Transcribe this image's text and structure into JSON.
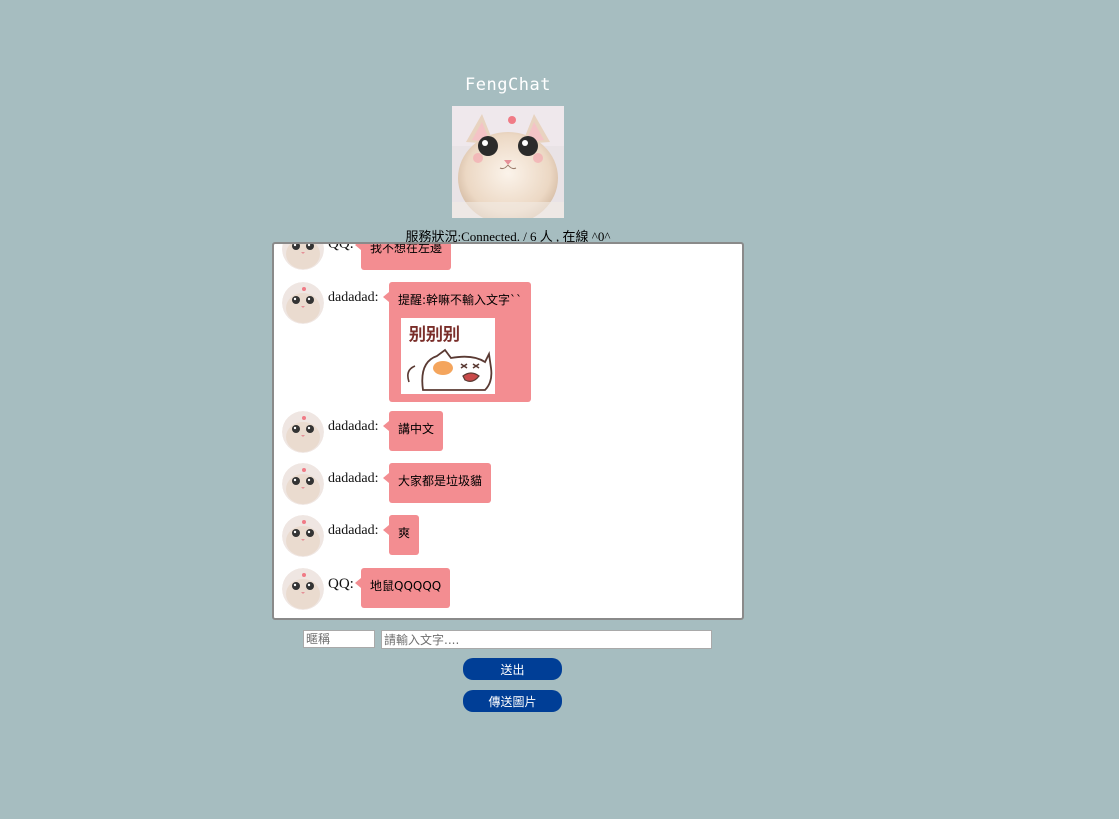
{
  "app": {
    "title": "FengChat",
    "status": "服務狀況:Connected. / 6 人 , 在線 ^0^"
  },
  "messages": [
    {
      "nick": "QQ:",
      "text": "我不想在左邊"
    },
    {
      "nick": "dadadad:",
      "text": "提醒:幹嘛不輸入文字``",
      "sticker": {
        "caption": "别别别"
      }
    },
    {
      "nick": "dadadad:",
      "text": "講中文"
    },
    {
      "nick": "dadadad:",
      "text": "大家都是垃圾貓"
    },
    {
      "nick": "dadadad:",
      "text": "爽"
    },
    {
      "nick": "QQ:",
      "text": "地鼠QQQQQ"
    }
  ],
  "composer": {
    "nickname_placeholder": "暱稱",
    "message_placeholder": "請輸入文字....",
    "send_label": "送出",
    "send_image_label": "傳送圖片"
  },
  "colors": {
    "page_background": "#a6bdc0",
    "bubble": "#f38d91",
    "button": "#003e96"
  },
  "icons": {
    "hero": "cat-photo",
    "avatar": "cat-avatar",
    "sticker": "crying-cat-sticker"
  }
}
